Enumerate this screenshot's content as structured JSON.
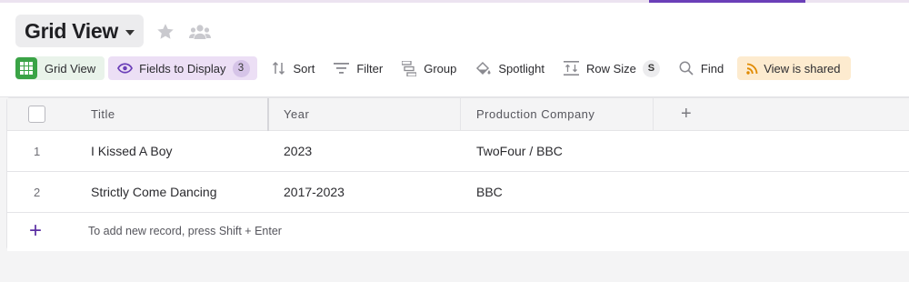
{
  "view": {
    "title": "Grid View"
  },
  "toolbar": {
    "grid_view": "Grid View",
    "fields_to_display": "Fields to Display",
    "fields_count": "3",
    "sort": "Sort",
    "filter": "Filter",
    "group": "Group",
    "spotlight": "Spotlight",
    "row_size": "Row Size",
    "row_size_value": "S",
    "find": "Find",
    "view_shared": "View is shared"
  },
  "icons": {
    "grid_view": "grid-icon",
    "fields": "eye-icon",
    "sort": "sort-arrows-icon",
    "filter": "filter-lines-icon",
    "group": "group-icon",
    "spotlight": "paint-bucket-icon",
    "row_size": "row-height-icon",
    "find": "magnifier-icon",
    "shared": "rss-icon",
    "star": "star-icon",
    "collaborators": "people-icon"
  },
  "colors": {
    "accent_purple": "#6b3fb8",
    "grid_green": "#3aa346",
    "fields_bg": "#ecdff5",
    "shared_bg": "#fdebcf",
    "shared_icon": "#e08a00"
  },
  "table": {
    "columns": [
      "Title",
      "Year",
      "Production Company"
    ],
    "add_column": "+",
    "rows": [
      {
        "num": "1",
        "title": "I Kissed A Boy",
        "year": "2023",
        "company": "TwoFour / BBC"
      },
      {
        "num": "2",
        "title": "Strictly Come Dancing",
        "year": "2017-2023",
        "company": "BBC"
      }
    ],
    "add_record_symbol": "+",
    "add_record_hint": "To add new record, press Shift + Enter"
  }
}
